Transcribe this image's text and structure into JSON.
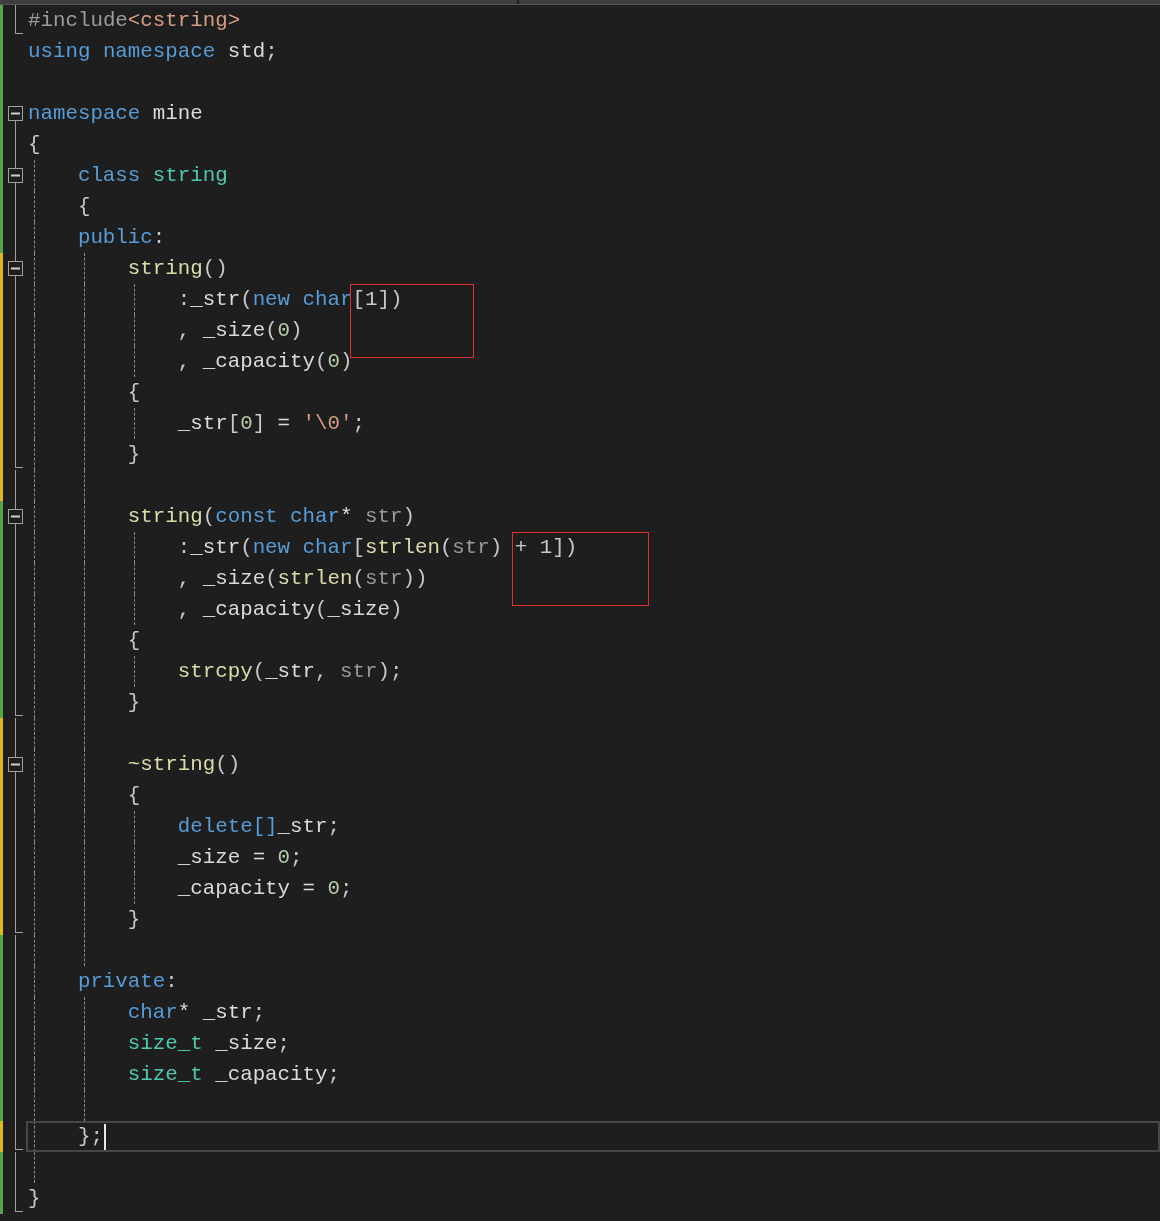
{
  "editor": {
    "lines": [
      {
        "collapsible": false,
        "fold_end": true,
        "modified": false,
        "current": false,
        "tokens": [
          {
            "text": "#include",
            "kind": "macro"
          },
          {
            "text": "<cstring>",
            "kind": "str"
          }
        ]
      },
      {
        "collapsible": false,
        "fold_end": false,
        "modified": false,
        "current": false,
        "tokens": [
          {
            "text": "using",
            "kind": "kw"
          },
          {
            "text": " namespace",
            "kind": "kw"
          },
          {
            "text": " std",
            "kind": "plain"
          },
          {
            "text": ";",
            "kind": "punct"
          }
        ]
      },
      {
        "collapsible": false,
        "fold_end": false,
        "modified": false,
        "current": false
      },
      {
        "collapsible": true,
        "fold_end": false,
        "modified": false,
        "current": false,
        "tokens": [
          {
            "text": "namespace",
            "kind": "kw"
          },
          {
            "text": " mine",
            "kind": "plain"
          }
        ]
      },
      {
        "collapsible": false,
        "fold_end": false,
        "modified": false,
        "current": false,
        "tokens": [
          {
            "text": "{",
            "kind": "punct"
          }
        ]
      },
      {
        "collapsible": true,
        "fold_end": false,
        "modified": false,
        "current": false,
        "tokens": [
          {
            "text": "    class",
            "kind": "kw"
          },
          {
            "text": " string",
            "kind": "type"
          }
        ]
      },
      {
        "collapsible": false,
        "fold_end": false,
        "modified": false,
        "current": false,
        "tokens": [
          {
            "text": "    {",
            "kind": "punct"
          }
        ]
      },
      {
        "collapsible": false,
        "fold_end": false,
        "modified": false,
        "current": false,
        "tokens": [
          {
            "text": "    public",
            "kind": "kw"
          },
          {
            "text": ":",
            "kind": "punct"
          }
        ]
      },
      {
        "collapsible": true,
        "fold_end": false,
        "modified": true,
        "current": false,
        "tokens": [
          {
            "text": "        string",
            "kind": "fn"
          },
          {
            "text": "()",
            "kind": "punct"
          }
        ]
      },
      {
        "collapsible": false,
        "fold_end": false,
        "modified": true,
        "current": false,
        "tokens": [
          {
            "text": "            :",
            "kind": "punct"
          },
          {
            "text": "_str",
            "kind": "plain"
          },
          {
            "text": "(",
            "kind": "punct"
          },
          {
            "text": "new",
            "kind": "kw"
          },
          {
            "text": " char",
            "kind": "kw"
          },
          {
            "text": "[1])",
            "kind": "punct",
            "highlight": true
          }
        ]
      },
      {
        "collapsible": false,
        "fold_end": false,
        "modified": true,
        "current": false,
        "tokens": [
          {
            "text": "            ,",
            "kind": "punct"
          },
          {
            "text": " _size",
            "kind": "plain"
          },
          {
            "text": "(",
            "kind": "punct"
          },
          {
            "text": "0",
            "kind": "num"
          },
          {
            "text": ")",
            "kind": "punct"
          }
        ]
      },
      {
        "collapsible": false,
        "fold_end": false,
        "modified": true,
        "current": false,
        "tokens": [
          {
            "text": "            ,",
            "kind": "punct"
          },
          {
            "text": " _capacity",
            "kind": "plain"
          },
          {
            "text": "(",
            "kind": "punct"
          },
          {
            "text": "0",
            "kind": "num"
          },
          {
            "text": ")",
            "kind": "punct"
          }
        ]
      },
      {
        "collapsible": false,
        "fold_end": false,
        "modified": true,
        "current": false,
        "tokens": [
          {
            "text": "        {",
            "kind": "punct"
          }
        ]
      },
      {
        "collapsible": false,
        "fold_end": false,
        "modified": true,
        "current": false,
        "tokens": [
          {
            "text": "            _str",
            "kind": "plain"
          },
          {
            "text": "[",
            "kind": "punct"
          },
          {
            "text": "0",
            "kind": "num"
          },
          {
            "text": "]",
            "kind": "punct"
          },
          {
            "text": " = ",
            "kind": "plain"
          },
          {
            "text": "'\\0'",
            "kind": "str"
          },
          {
            "text": ";",
            "kind": "punct"
          }
        ]
      },
      {
        "collapsible": false,
        "fold_end": true,
        "modified": true,
        "current": false,
        "tokens": [
          {
            "text": "        }",
            "kind": "punct"
          }
        ]
      },
      {
        "collapsible": false,
        "fold_end": false,
        "modified": true,
        "current": false
      },
      {
        "collapsible": true,
        "fold_end": false,
        "modified": false,
        "current": false,
        "tokens": [
          {
            "text": "        string",
            "kind": "fn"
          },
          {
            "text": "(",
            "kind": "punct"
          },
          {
            "text": "const",
            "kind": "kw"
          },
          {
            "text": " char",
            "kind": "kw"
          },
          {
            "text": "*",
            "kind": "plain"
          },
          {
            "text": " str",
            "kind": "param"
          },
          {
            "text": ")",
            "kind": "punct"
          }
        ]
      },
      {
        "collapsible": false,
        "fold_end": false,
        "modified": false,
        "current": false,
        "tokens": [
          {
            "text": "            :",
            "kind": "punct"
          },
          {
            "text": "_str",
            "kind": "plain"
          },
          {
            "text": "(",
            "kind": "punct"
          },
          {
            "text": "new",
            "kind": "kw"
          },
          {
            "text": " char",
            "kind": "kw"
          },
          {
            "text": "[",
            "kind": "punct"
          },
          {
            "text": "strlen",
            "kind": "fn"
          },
          {
            "text": "(",
            "kind": "punct"
          },
          {
            "text": "str",
            "kind": "param"
          },
          {
            "text": ") ",
            "kind": "punct"
          },
          {
            "text": "+ 1])",
            "kind": "punct",
            "highlight": true
          }
        ]
      },
      {
        "collapsible": false,
        "fold_end": false,
        "modified": false,
        "current": false,
        "tokens": [
          {
            "text": "            ,",
            "kind": "punct"
          },
          {
            "text": " _size",
            "kind": "plain"
          },
          {
            "text": "(",
            "kind": "punct"
          },
          {
            "text": "strlen",
            "kind": "fn"
          },
          {
            "text": "(",
            "kind": "punct"
          },
          {
            "text": "str",
            "kind": "param"
          },
          {
            "text": "))",
            "kind": "punct"
          }
        ]
      },
      {
        "collapsible": false,
        "fold_end": false,
        "modified": false,
        "current": false,
        "tokens": [
          {
            "text": "            ,",
            "kind": "punct"
          },
          {
            "text": " _capacity",
            "kind": "plain"
          },
          {
            "text": "(",
            "kind": "punct"
          },
          {
            "text": "_size",
            "kind": "plain"
          },
          {
            "text": ")",
            "kind": "punct"
          }
        ]
      },
      {
        "collapsible": false,
        "fold_end": false,
        "modified": false,
        "current": false,
        "tokens": [
          {
            "text": "        {",
            "kind": "punct"
          }
        ]
      },
      {
        "collapsible": false,
        "fold_end": false,
        "modified": false,
        "current": false,
        "tokens": [
          {
            "text": "            strcpy",
            "kind": "fn"
          },
          {
            "text": "(",
            "kind": "punct"
          },
          {
            "text": "_str",
            "kind": "plain"
          },
          {
            "text": ", ",
            "kind": "punct"
          },
          {
            "text": "str",
            "kind": "param"
          },
          {
            "text": ");",
            "kind": "punct"
          }
        ]
      },
      {
        "collapsible": false,
        "fold_end": true,
        "modified": false,
        "current": false,
        "tokens": [
          {
            "text": "        }",
            "kind": "punct"
          }
        ]
      },
      {
        "collapsible": false,
        "fold_end": false,
        "modified": true,
        "current": false
      },
      {
        "collapsible": true,
        "fold_end": false,
        "modified": true,
        "current": false,
        "tokens": [
          {
            "text": "        ~string",
            "kind": "fn"
          },
          {
            "text": "()",
            "kind": "punct"
          }
        ]
      },
      {
        "collapsible": false,
        "fold_end": false,
        "modified": true,
        "current": false,
        "tokens": [
          {
            "text": "        {",
            "kind": "punct"
          }
        ]
      },
      {
        "collapsible": false,
        "fold_end": false,
        "modified": true,
        "current": false,
        "tokens": [
          {
            "text": "            delete",
            "kind": "kw"
          },
          {
            "text": "[]",
            "kind": "kw"
          },
          {
            "text": "_str",
            "kind": "plain"
          },
          {
            "text": ";",
            "kind": "punct"
          }
        ]
      },
      {
        "collapsible": false,
        "fold_end": false,
        "modified": true,
        "current": false,
        "tokens": [
          {
            "text": "            _size",
            "kind": "plain"
          },
          {
            "text": " = ",
            "kind": "plain"
          },
          {
            "text": "0",
            "kind": "num"
          },
          {
            "text": ";",
            "kind": "punct"
          }
        ]
      },
      {
        "collapsible": false,
        "fold_end": false,
        "modified": true,
        "current": false,
        "tokens": [
          {
            "text": "            _capacity",
            "kind": "plain"
          },
          {
            "text": " = ",
            "kind": "plain"
          },
          {
            "text": "0",
            "kind": "num"
          },
          {
            "text": ";",
            "kind": "punct"
          }
        ]
      },
      {
        "collapsible": false,
        "fold_end": true,
        "modified": true,
        "current": false,
        "tokens": [
          {
            "text": "        }",
            "kind": "punct"
          }
        ]
      },
      {
        "collapsible": false,
        "fold_end": false,
        "modified": false,
        "current": false
      },
      {
        "collapsible": false,
        "fold_end": false,
        "modified": false,
        "current": false,
        "tokens": [
          {
            "text": "    private",
            "kind": "kw"
          },
          {
            "text": ":",
            "kind": "punct"
          }
        ]
      },
      {
        "collapsible": false,
        "fold_end": false,
        "modified": false,
        "current": false,
        "tokens": [
          {
            "text": "        char",
            "kind": "kw"
          },
          {
            "text": "*",
            "kind": "plain"
          },
          {
            "text": " _str",
            "kind": "plain"
          },
          {
            "text": ";",
            "kind": "punct"
          }
        ]
      },
      {
        "collapsible": false,
        "fold_end": false,
        "modified": false,
        "current": false,
        "tokens": [
          {
            "text": "        size_t",
            "kind": "type"
          },
          {
            "text": " _size",
            "kind": "plain"
          },
          {
            "text": ";",
            "kind": "punct"
          }
        ]
      },
      {
        "collapsible": false,
        "fold_end": false,
        "modified": false,
        "current": false,
        "tokens": [
          {
            "text": "        size_t",
            "kind": "type"
          },
          {
            "text": " _capacity",
            "kind": "plain"
          },
          {
            "text": ";",
            "kind": "punct"
          }
        ]
      },
      {
        "collapsible": false,
        "fold_end": false,
        "modified": false,
        "current": false
      },
      {
        "collapsible": false,
        "fold_end": true,
        "modified": true,
        "current": true,
        "tokens": [
          {
            "text": "    }",
            "kind": "punct"
          },
          {
            "text": ";",
            "kind": "punct"
          }
        ]
      },
      {
        "collapsible": false,
        "fold_end": false,
        "modified": false,
        "current": false
      },
      {
        "collapsible": false,
        "fold_end": true,
        "modified": false,
        "current": false,
        "tokens": [
          {
            "text": "}",
            "kind": "punct"
          }
        ]
      }
    ]
  }
}
